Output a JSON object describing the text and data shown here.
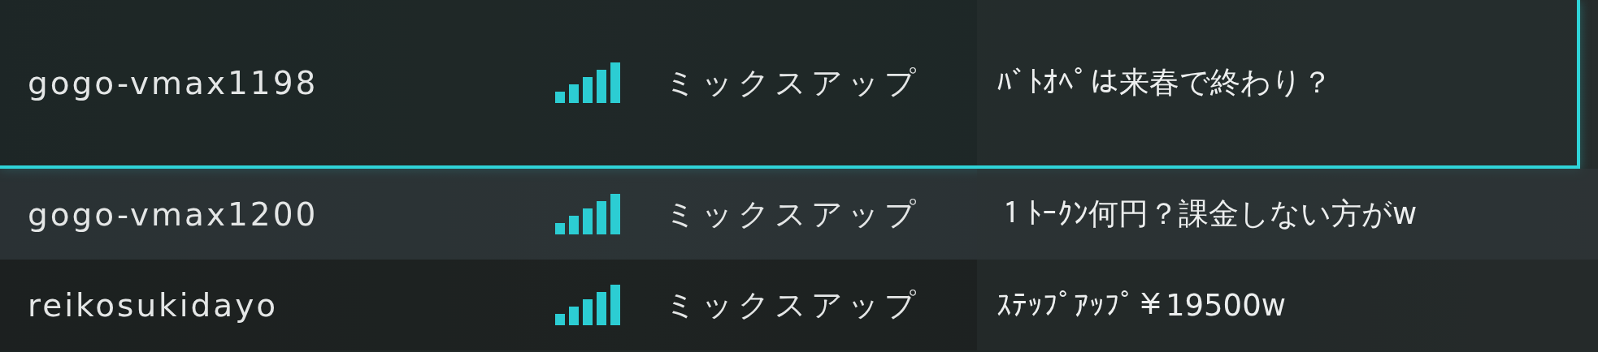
{
  "rooms": [
    {
      "name": "gogo-vmax1198",
      "mode": "ミックスアップ",
      "comment": "ﾊﾞﾄｵﾍﾟは来春で終わり？",
      "selected": true
    },
    {
      "name": "gogo-vmax1200",
      "mode": "ミックスアップ",
      "comment": "１ﾄｰｸﾝ何円？課金しない方がw",
      "selected": false
    },
    {
      "name": "reikosukidayo",
      "mode": "ミックスアップ",
      "comment": "ｽﾃｯﾌﾟｱｯﾌﾟ￥19500w",
      "selected": false
    }
  ]
}
